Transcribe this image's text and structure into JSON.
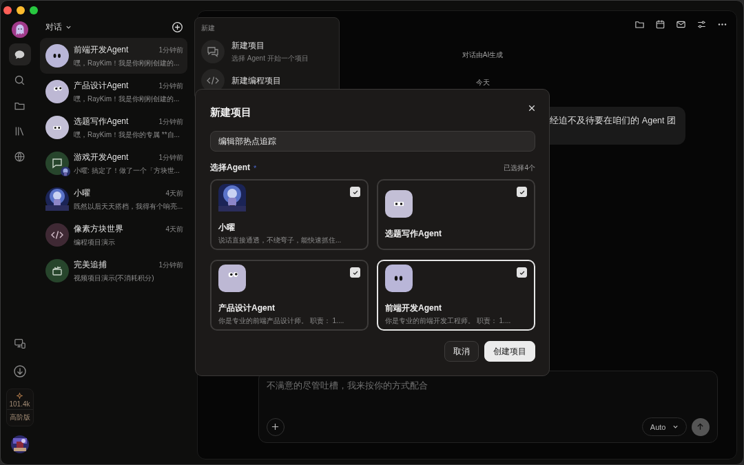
{
  "rail": {
    "items": [
      {
        "kind": "chat",
        "selected": true
      },
      {
        "kind": "search",
        "selected": false
      },
      {
        "kind": "folder",
        "selected": false
      },
      {
        "kind": "library",
        "selected": false
      },
      {
        "kind": "globe",
        "selected": false
      }
    ],
    "credits": {
      "amount": "101.4k",
      "plan": "高阶版"
    }
  },
  "conversations": {
    "title": "对话",
    "items": [
      {
        "name": "前端开发Agent",
        "time": "1分钟前",
        "preview": "嘿，RayKim！我是你刚刚创建的...",
        "kind": "oval-eyes",
        "badge": false,
        "selected": true
      },
      {
        "name": "产品设计Agent",
        "time": "1分钟前",
        "preview": "嘿，RayKim！我是你刚刚创建的...",
        "kind": "googly-eyes",
        "badge": false,
        "selected": false
      },
      {
        "name": "选题写作Agent",
        "time": "1分钟前",
        "preview": "嘿，RayKim！我是你的专属 **自...",
        "kind": "square-eyes",
        "badge": false,
        "selected": false
      },
      {
        "name": "游戏开发Agent",
        "time": "1分钟前",
        "preview": "小曜: 搞定了！做了一个「方块世...",
        "kind": "chat",
        "badge": true,
        "selected": false
      },
      {
        "name": "小曜",
        "time": "4天前",
        "preview": "既然以后天天搭档，我得有个响亮...",
        "badge": false,
        "selected": false
      },
      {
        "name": "像素方块世界",
        "time": "4天前",
        "preview": "编程项目演示",
        "kind": "code",
        "badge": false,
        "selected": false
      },
      {
        "name": "完美追捕",
        "time": "1分钟前",
        "preview": "视频项目演示(不消耗积分)",
        "kind": "clapper",
        "badge": false,
        "selected": false
      }
    ]
  },
  "new_menu": {
    "heading": "新建",
    "items": [
      {
        "kind": "chat",
        "title": "新建项目",
        "subtitle": "选择 Agent 开始一个项目"
      },
      {
        "kind": "code",
        "title": "新建编程项目"
      }
    ]
  },
  "chat": {
    "notice": "对话由AI生成",
    "date": "今天",
    "message": "经迫不及待要在咱们的 Agent 团"
  },
  "composer": {
    "placeholder": "不满意的尽管吐槽，我来按你的方式配合",
    "model": "Auto"
  },
  "dialog": {
    "title": "新建项目",
    "name_value": "编辑部热点追踪",
    "section": "选择Agent",
    "required_mark": "*",
    "count": "已选择4个",
    "agents": [
      {
        "name": "小曜",
        "description": "说话直接通透，不绕弯子，能快速抓住...",
        "checked": true,
        "selected": false
      },
      {
        "name": "选题写作Agent",
        "kind": "square-eyes",
        "checked": true,
        "selected": false
      },
      {
        "name": "产品设计Agent",
        "description": "你是专业的前端产品设计师。 职责： 1....",
        "kind": "googly-eyes",
        "checked": true,
        "selected": false
      },
      {
        "name": "前端开发Agent",
        "description": "你是专业的前端开发工程师。 职责： 1....",
        "kind": "oval-eyes",
        "checked": true,
        "selected": true
      }
    ],
    "buttons": [
      {
        "kind": "secondary",
        "label": "取消"
      },
      {
        "kind": "primary",
        "label": "创建项目"
      }
    ]
  }
}
